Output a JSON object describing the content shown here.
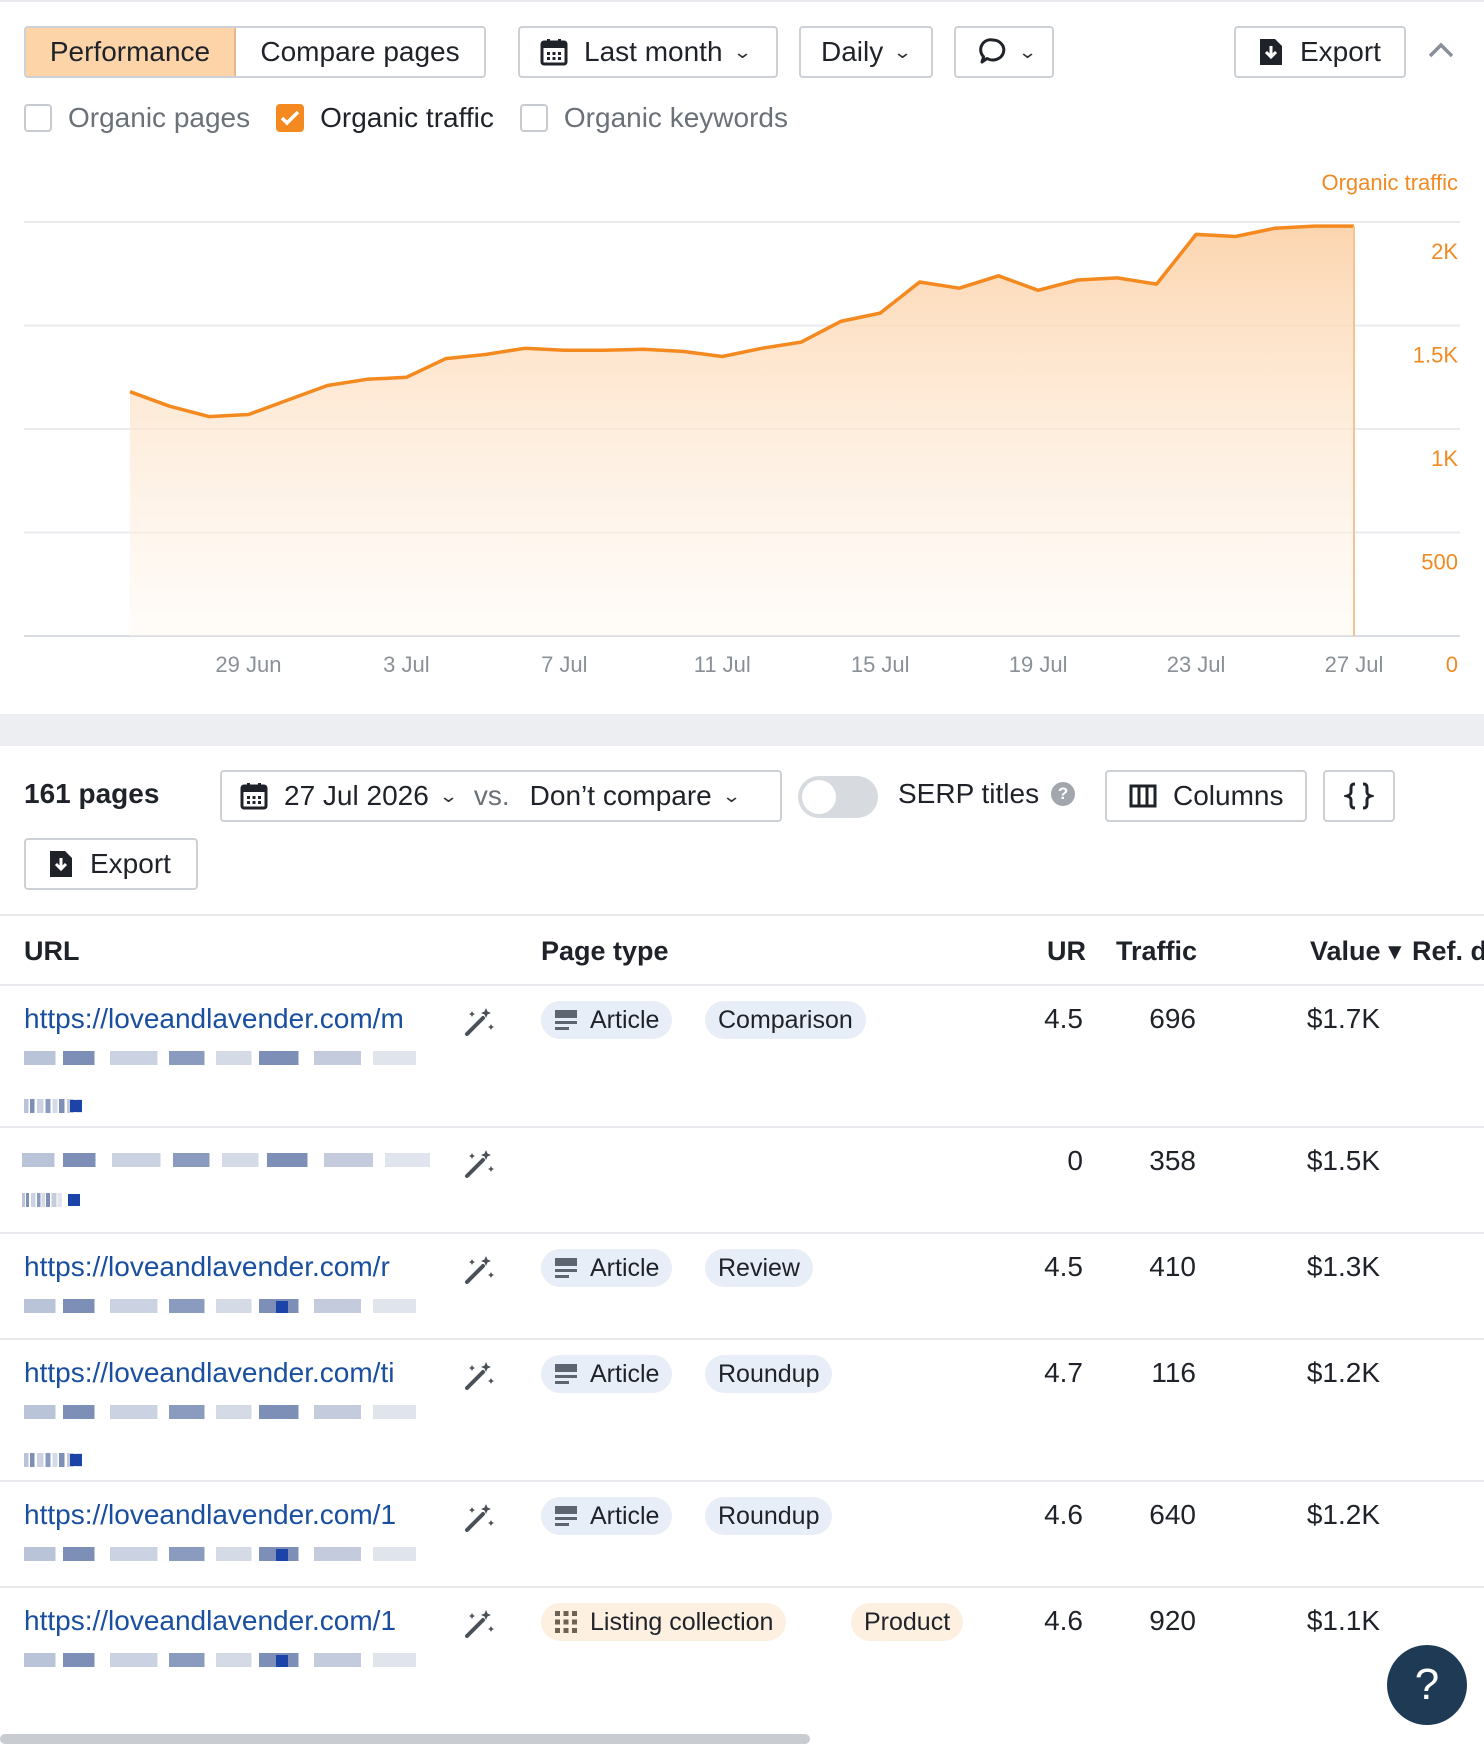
{
  "toolbar": {
    "tab_performance": "Performance",
    "tab_compare": "Compare pages",
    "period": "Last month",
    "interval": "Daily",
    "export": "Export"
  },
  "metrics": {
    "organic_pages": "Organic pages",
    "organic_traffic": "Organic traffic",
    "organic_keywords": "Organic keywords"
  },
  "colors": {
    "accent": "#f48a1f",
    "tab_active_bg": "#fdd3a8",
    "link": "#1a4fa0"
  },
  "chart_data": {
    "type": "area",
    "series": [
      {
        "name": "Organic traffic",
        "x": [
          "26 Jun",
          "27 Jun",
          "28 Jun",
          "29 Jun",
          "30 Jun",
          "1 Jul",
          "2 Jul",
          "3 Jul",
          "4 Jul",
          "5 Jul",
          "6 Jul",
          "7 Jul",
          "8 Jul",
          "9 Jul",
          "10 Jul",
          "11 Jul",
          "12 Jul",
          "13 Jul",
          "14 Jul",
          "15 Jul",
          "16 Jul",
          "17 Jul",
          "18 Jul",
          "19 Jul",
          "20 Jul",
          "21 Jul",
          "22 Jul",
          "23 Jul",
          "24 Jul",
          "25 Jul",
          "26 Jul",
          "27 Jul"
        ],
        "values": [
          1180,
          1110,
          1060,
          1070,
          1140,
          1210,
          1240,
          1250,
          1340,
          1360,
          1390,
          1380,
          1380,
          1385,
          1375,
          1350,
          1390,
          1420,
          1520,
          1560,
          1710,
          1680,
          1740,
          1670,
          1720,
          1730,
          1700,
          1940,
          1930,
          1970,
          1980,
          1980
        ]
      }
    ],
    "xticks": [
      "29 Jun",
      "3 Jul",
      "7 Jul",
      "11 Jul",
      "15 Jul",
      "19 Jul",
      "23 Jul",
      "27 Jul"
    ],
    "yticks": [
      "0",
      "500",
      "1K",
      "1.5K",
      "2K"
    ],
    "ylabel": "Organic traffic",
    "ylim": [
      0,
      2000
    ],
    "grid": true
  },
  "table_toolbar": {
    "pages_count": "161 pages",
    "date": "27 Jul 2026",
    "vs": "vs.",
    "compare": "Don’t compare",
    "serp_titles": "SERP titles",
    "serp_help": "?",
    "columns": "Columns",
    "export": "Export"
  },
  "table": {
    "headers": {
      "url": "URL",
      "page_type": "Page type",
      "ur": "UR",
      "traffic": "Traffic",
      "value": "Value ▾",
      "ref": "Ref. d"
    },
    "rows": [
      {
        "url": "https://loveandlavender.com/m",
        "tags": [
          "Article",
          "Comparison"
        ],
        "ur": "4.5",
        "traffic": "696",
        "value": "$1.7K"
      },
      {
        "url": "",
        "tags": [],
        "ur": "0",
        "traffic": "358",
        "value": "$1.5K"
      },
      {
        "url": "https://loveandlavender.com/r",
        "tags": [
          "Article",
          "Review"
        ],
        "ur": "4.5",
        "traffic": "410",
        "value": "$1.3K"
      },
      {
        "url": "https://loveandlavender.com/ti",
        "tags": [
          "Article",
          "Roundup"
        ],
        "ur": "4.7",
        "traffic": "116",
        "value": "$1.2K"
      },
      {
        "url": "https://loveandlavender.com/1",
        "tags": [
          "Article",
          "Roundup"
        ],
        "ur": "4.6",
        "traffic": "640",
        "value": "$1.2K"
      },
      {
        "url": "https://loveandlavender.com/1",
        "tags": [
          "Listing collection",
          "Product"
        ],
        "ur": "4.6",
        "traffic": "920",
        "value": "$1.1K"
      }
    ]
  },
  "help": "?"
}
